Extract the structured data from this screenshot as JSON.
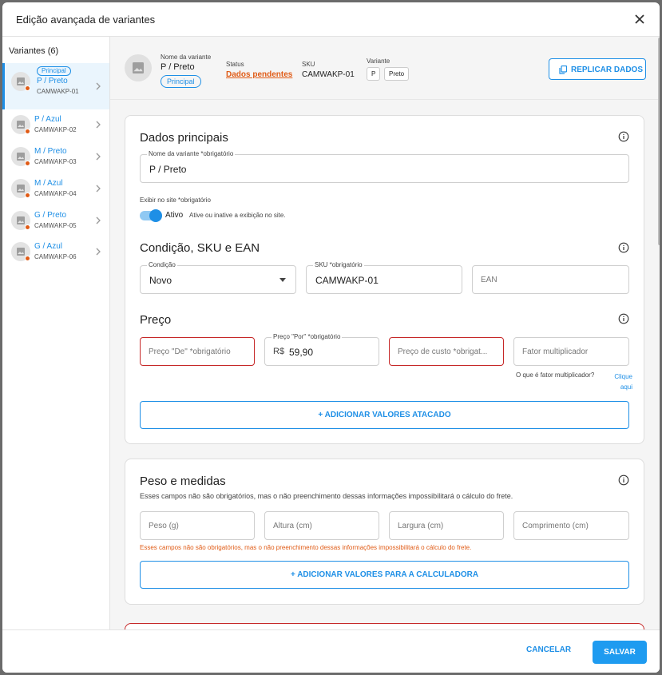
{
  "modal": {
    "title": "Edição avançada de variantes",
    "close_icon": "close-icon"
  },
  "sidebar": {
    "title": "Variantes (6)",
    "items": [
      {
        "badge": "Principal",
        "name": "P / Preto",
        "sku": "CAMWAKP-01",
        "active": true
      },
      {
        "name": "P / Azul",
        "sku": "CAMWAKP-02"
      },
      {
        "name": "M / Preto",
        "sku": "CAMWAKP-03"
      },
      {
        "name": "M / Azul",
        "sku": "CAMWAKP-04"
      },
      {
        "name": "G / Preto",
        "sku": "CAMWAKP-05"
      },
      {
        "name": "G / Azul",
        "sku": "CAMWAKP-06"
      }
    ]
  },
  "topbar": {
    "name_label": "Nome da variante",
    "name": "P / Preto",
    "badge": "Principal",
    "status_label": "Status",
    "status": "Dados pendentes",
    "sku_label": "SKU",
    "sku": "CAMWAKP-01",
    "variant_label": "Variante",
    "chips": [
      "P",
      "Preto"
    ],
    "replicar": "REPLICAR DADOS"
  },
  "dados": {
    "title": "Dados principais",
    "name_field_label": "Nome da variante *obrigatório",
    "name_field_value": "P / Preto",
    "exibir_label": "Exibir no site *obrigatório",
    "toggle_label": "Ativo",
    "toggle_hint": "Ative ou inative a exibição no site.",
    "toggle_on": true
  },
  "condicao": {
    "title": "Condição, SKU e EAN",
    "condicao_label": "Condição",
    "condicao_value": "Novo",
    "sku_label": "SKU *obrigatório",
    "sku_value": "CAMWAKP-01",
    "ean_placeholder": "EAN"
  },
  "preco": {
    "title": "Preço",
    "de_placeholder": "Preço \"De\" *obrigatório",
    "por_label": "Preço \"Por\" *obrigatório",
    "por_currency": "R$",
    "por_value": "59,90",
    "custo_placeholder": "Preço de custo *obrigat...",
    "fator_placeholder": "Fator multiplicador",
    "fator_hint": "O que é fator multiplicador?",
    "fator_link": "Clique aqui",
    "atacado_button": "+ ADICIONAR VALORES ATACADO"
  },
  "peso": {
    "title": "Peso e medidas",
    "subtitle": "Esses campos não são obrigatórios, mas o não preenchimento dessas informações impossibilitará o cálculo do frete.",
    "peso_placeholder": "Peso (g)",
    "altura_placeholder": "Altura (cm)",
    "largura_placeholder": "Largura (cm)",
    "comprimento_placeholder": "Comprimento (cm)",
    "warning": "Esses campos não são obrigatórios, mas o não preenchimento dessas informações impossibilitará o cálculo do frete.",
    "calc_button": "+ ADICIONAR VALORES PARA A CALCULADORA"
  },
  "footer": {
    "cancel": "CANCELAR",
    "save": "SALVAR"
  },
  "colors": {
    "accent": "#1e8fe6",
    "warning": "#e05b16",
    "error": "#c62828"
  }
}
